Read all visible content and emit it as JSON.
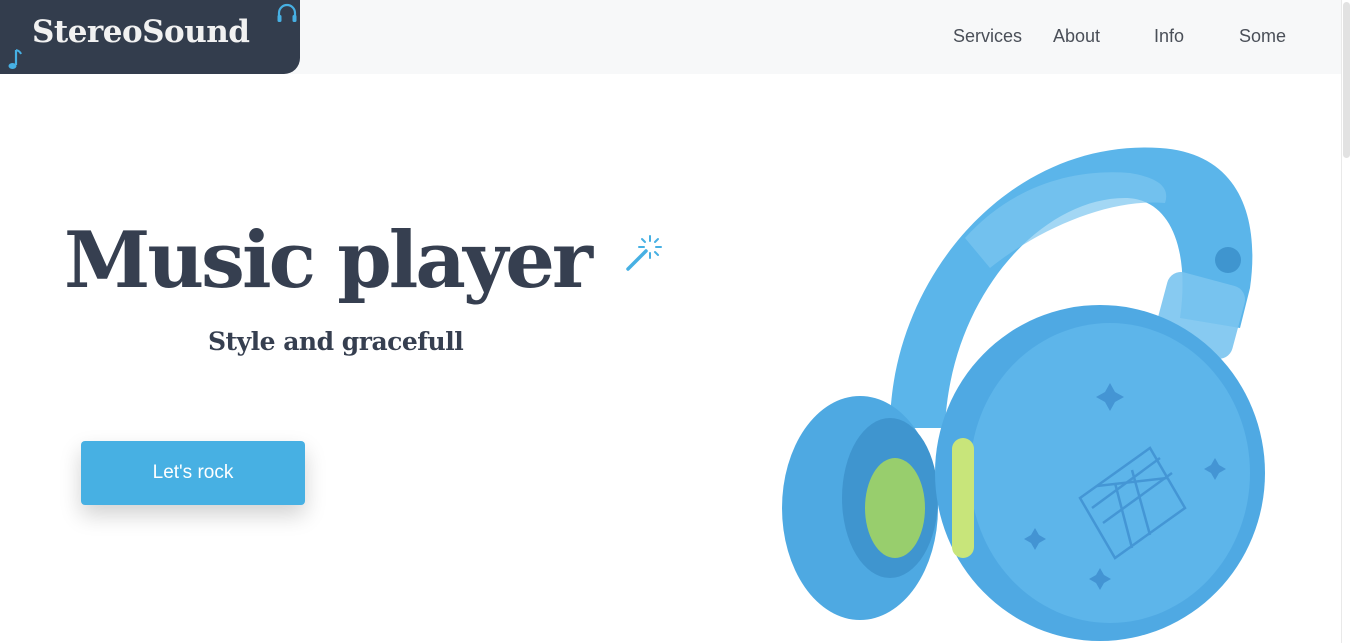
{
  "brand": {
    "name": "StereoSound",
    "icons": [
      "music-note-icon",
      "headphones-icon"
    ],
    "bg_color": "#333d4d",
    "accent_color": "#47b0e3"
  },
  "nav": {
    "items": [
      {
        "label": "Services"
      },
      {
        "label": "About"
      },
      {
        "label": "Info"
      },
      {
        "label": "Some"
      }
    ]
  },
  "hero": {
    "title": "Music player",
    "title_icon": "magic-wand-icon",
    "subtitle": "Style and gracefull",
    "cta_label": "Let's rock",
    "image": "headphones-product-image",
    "image_color": "#5ab4ea"
  }
}
